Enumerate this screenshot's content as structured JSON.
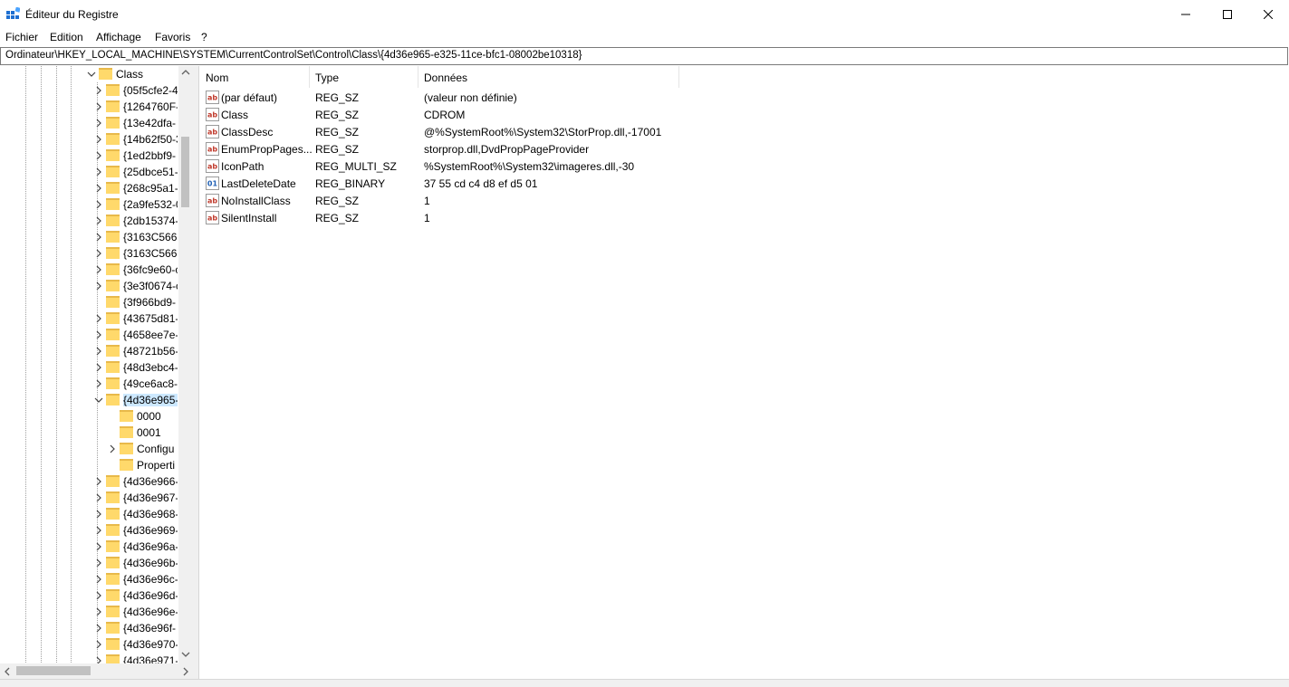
{
  "window": {
    "title": "Éditeur du Registre",
    "icon": "registry-editor-icon",
    "controls": {
      "minimize": "minimize-icon",
      "maximize": "maximize-icon",
      "close": "close-icon"
    }
  },
  "menu": [
    "Fichier",
    "Edition",
    "Affichage",
    "Favoris",
    "?"
  ],
  "address": "Ordinateur\\HKEY_LOCAL_MACHINE\\SYSTEM\\CurrentControlSet\\Control\\Class\\{4d36e965-e325-11ce-bfc1-08002be10318}",
  "tree": {
    "items": [
      {
        "label": "Class",
        "level": 0,
        "expander": "expanded"
      },
      {
        "label": "{05f5cfe2-4",
        "level": 1,
        "expander": "collapsed"
      },
      {
        "label": "{1264760F-",
        "level": 1,
        "expander": "collapsed"
      },
      {
        "label": "{13e42dfa-",
        "level": 1,
        "expander": "collapsed"
      },
      {
        "label": "{14b62f50-3",
        "level": 1,
        "expander": "collapsed"
      },
      {
        "label": "{1ed2bbf9-",
        "level": 1,
        "expander": "collapsed"
      },
      {
        "label": "{25dbce51-",
        "level": 1,
        "expander": "collapsed"
      },
      {
        "label": "{268c95a1-",
        "level": 1,
        "expander": "collapsed"
      },
      {
        "label": "{2a9fe532-0",
        "level": 1,
        "expander": "collapsed"
      },
      {
        "label": "{2db15374-",
        "level": 1,
        "expander": "collapsed"
      },
      {
        "label": "{3163C566-",
        "level": 1,
        "expander": "collapsed"
      },
      {
        "label": "{3163C566-",
        "level": 1,
        "expander": "collapsed"
      },
      {
        "label": "{36fc9e60-c",
        "level": 1,
        "expander": "collapsed"
      },
      {
        "label": "{3e3f0674-c",
        "level": 1,
        "expander": "collapsed"
      },
      {
        "label": "{3f966bd9-",
        "level": 1,
        "expander": "none"
      },
      {
        "label": "{43675d81-",
        "level": 1,
        "expander": "collapsed"
      },
      {
        "label": "{4658ee7e-",
        "level": 1,
        "expander": "collapsed"
      },
      {
        "label": "{48721b56-",
        "level": 1,
        "expander": "collapsed"
      },
      {
        "label": "{48d3ebc4-",
        "level": 1,
        "expander": "collapsed"
      },
      {
        "label": "{49ce6ac8-",
        "level": 1,
        "expander": "collapsed"
      },
      {
        "label": "{4d36e965-",
        "level": 1,
        "expander": "expanded",
        "selected": true
      },
      {
        "label": "0000",
        "level": 2,
        "expander": "none"
      },
      {
        "label": "0001",
        "level": 2,
        "expander": "none"
      },
      {
        "label": "Configu",
        "level": 2,
        "expander": "collapsed"
      },
      {
        "label": "Properti",
        "level": 2,
        "expander": "none"
      },
      {
        "label": "{4d36e966-",
        "level": 1,
        "expander": "collapsed"
      },
      {
        "label": "{4d36e967-",
        "level": 1,
        "expander": "collapsed"
      },
      {
        "label": "{4d36e968-",
        "level": 1,
        "expander": "collapsed"
      },
      {
        "label": "{4d36e969-",
        "level": 1,
        "expander": "collapsed"
      },
      {
        "label": "{4d36e96a-",
        "level": 1,
        "expander": "collapsed"
      },
      {
        "label": "{4d36e96b-",
        "level": 1,
        "expander": "collapsed"
      },
      {
        "label": "{4d36e96c-",
        "level": 1,
        "expander": "collapsed"
      },
      {
        "label": "{4d36e96d-",
        "level": 1,
        "expander": "collapsed"
      },
      {
        "label": "{4d36e96e-",
        "level": 1,
        "expander": "collapsed"
      },
      {
        "label": "{4d36e96f-",
        "level": 1,
        "expander": "collapsed"
      },
      {
        "label": "{4d36e970-",
        "level": 1,
        "expander": "collapsed"
      },
      {
        "label": "{4d36e971-",
        "level": 1,
        "expander": "collapsed"
      }
    ]
  },
  "values": {
    "columns": [
      "Nom",
      "Type",
      "Données"
    ],
    "rows": [
      {
        "name": "(par défaut)",
        "type": "REG_SZ",
        "data": "(valeur non définie)",
        "icon": "string-value-icon"
      },
      {
        "name": "Class",
        "type": "REG_SZ",
        "data": "CDROM",
        "icon": "string-value-icon"
      },
      {
        "name": "ClassDesc",
        "type": "REG_SZ",
        "data": "@%SystemRoot%\\System32\\StorProp.dll,-17001",
        "icon": "string-value-icon"
      },
      {
        "name": "EnumPropPages...",
        "type": "REG_SZ",
        "data": "storprop.dll,DvdPropPageProvider",
        "icon": "string-value-icon"
      },
      {
        "name": "IconPath",
        "type": "REG_MULTI_SZ",
        "data": "%SystemRoot%\\System32\\imageres.dll,-30",
        "icon": "string-value-icon"
      },
      {
        "name": "LastDeleteDate",
        "type": "REG_BINARY",
        "data": "37 55 cd c4 d8 ef d5 01",
        "icon": "binary-value-icon"
      },
      {
        "name": "NoInstallClass",
        "type": "REG_SZ",
        "data": "1",
        "icon": "string-value-icon"
      },
      {
        "name": "SilentInstall",
        "type": "REG_SZ",
        "data": "1",
        "icon": "string-value-icon"
      }
    ]
  },
  "colors": {
    "selection": "#cce8ff",
    "folder": "#ffd96b",
    "string_icon": "#c0392b",
    "binary_icon": "#1f5fb4"
  }
}
